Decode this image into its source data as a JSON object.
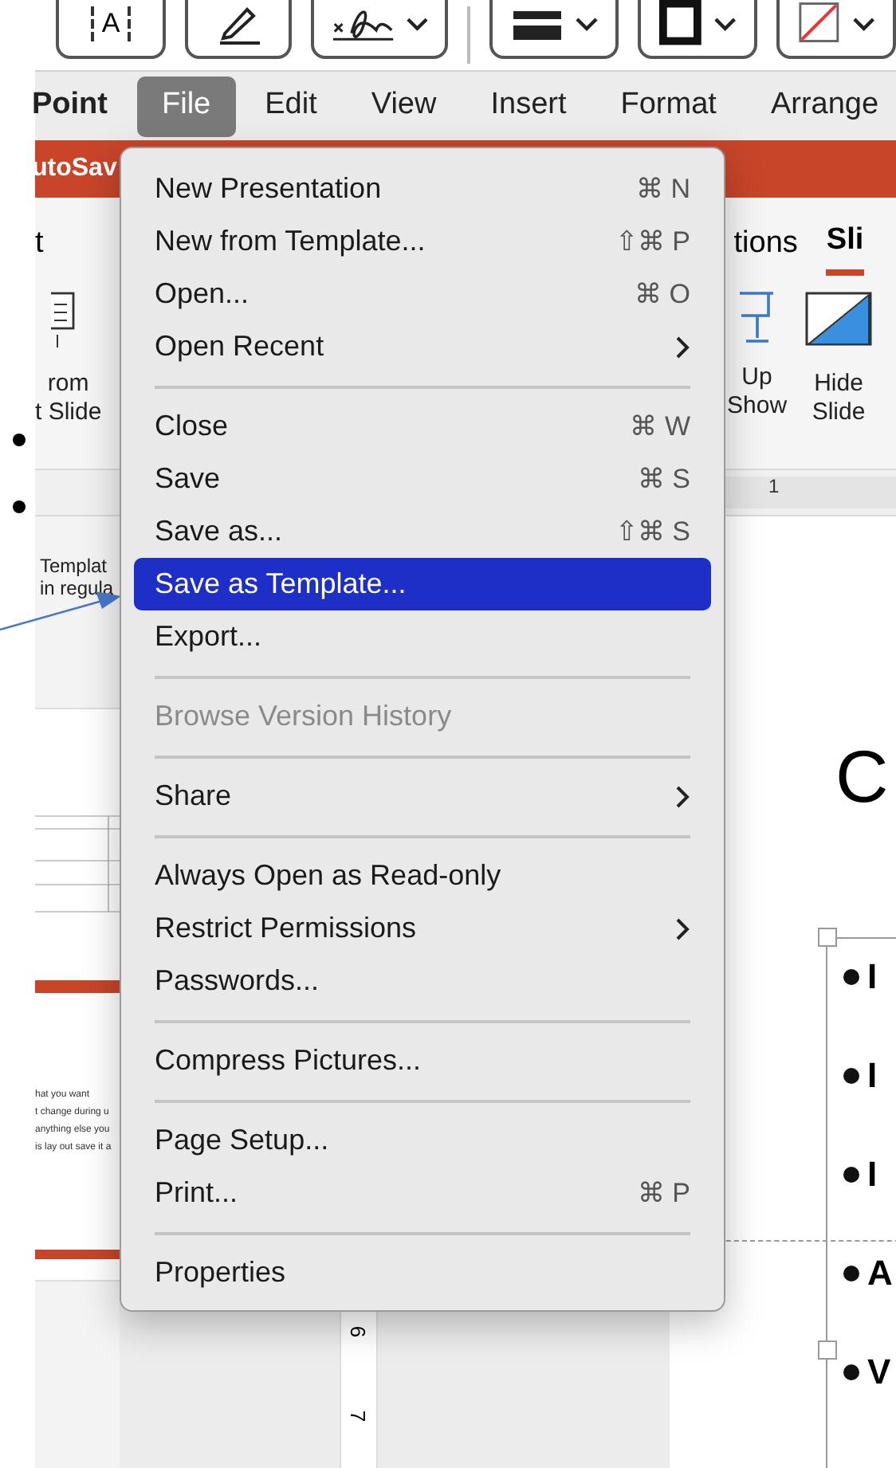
{
  "toolbar": [
    {
      "kind": "textbox",
      "label": "A",
      "dropdown": false
    },
    {
      "kind": "pen",
      "dropdown": false
    },
    {
      "kind": "signature",
      "dropdown": true
    },
    {
      "kind": "divider"
    },
    {
      "kind": "line_weight",
      "dropdown": true
    },
    {
      "kind": "border",
      "dropdown": true
    },
    {
      "kind": "no_color",
      "dropdown": true
    }
  ],
  "menu_bar": [
    {
      "label": "Point",
      "kind": "app"
    },
    {
      "label": "File",
      "kind": "menu",
      "selected": true
    },
    {
      "label": "Edit",
      "kind": "menu",
      "selected": false
    },
    {
      "label": "View",
      "kind": "menu",
      "selected": false
    },
    {
      "label": "Insert",
      "kind": "menu",
      "selected": false
    },
    {
      "label": "Format",
      "kind": "menu",
      "selected": false
    },
    {
      "label": "Arrange",
      "kind": "menu",
      "selected": false
    }
  ],
  "title_bar": {
    "autosave": "utoSav"
  },
  "ribbon": {
    "tabs": [
      {
        "label": "t",
        "selected": false
      },
      {
        "label": "tions",
        "selected": false
      },
      {
        "label": "Sli",
        "selected": true
      }
    ],
    "buttons": [
      {
        "kind": "layout",
        "lines": [
          "rom",
          "t Slide"
        ]
      },
      {
        "kind": "show",
        "lines": [
          "Up",
          "Show"
        ]
      },
      {
        "kind": "hide",
        "lines": [
          "Hide",
          "Slide"
        ]
      }
    ],
    "ruler": "1"
  },
  "annotation": {
    "lines": [
      "Templat",
      "in regula"
    ]
  },
  "thumbnail": {
    "lines": [
      "hat you want",
      "t change during u",
      "anything else you",
      "is lay out save it a"
    ]
  },
  "vertical_ruler": [
    "6",
    "7"
  ],
  "slide": {
    "title": "C",
    "bullets": [
      "I",
      "I",
      "I",
      "A",
      "V"
    ]
  },
  "file_menu": [
    {
      "kind": "item",
      "label": "New Presentation",
      "shortcut": "⌘ N",
      "submenu": false,
      "disabled": false,
      "selected": false
    },
    {
      "kind": "item",
      "label": "New from Template...",
      "shortcut": "⇧⌘ P",
      "submenu": false,
      "disabled": false,
      "selected": false
    },
    {
      "kind": "item",
      "label": "Open...",
      "shortcut": "⌘ O",
      "submenu": false,
      "disabled": false,
      "selected": false
    },
    {
      "kind": "item",
      "label": "Open Recent",
      "submenu": true,
      "disabled": false,
      "selected": false
    },
    {
      "kind": "separator"
    },
    {
      "kind": "item",
      "label": "Close",
      "shortcut": "⌘ W",
      "submenu": false,
      "disabled": false,
      "selected": false
    },
    {
      "kind": "item",
      "label": "Save",
      "shortcut": "⌘ S",
      "submenu": false,
      "disabled": false,
      "selected": false
    },
    {
      "kind": "item",
      "label": "Save as...",
      "shortcut": "⇧⌘ S",
      "submenu": false,
      "disabled": false,
      "selected": false
    },
    {
      "kind": "item",
      "label": "Save as Template...",
      "submenu": false,
      "disabled": false,
      "selected": true
    },
    {
      "kind": "item",
      "label": "Export...",
      "submenu": false,
      "disabled": false,
      "selected": false
    },
    {
      "kind": "separator"
    },
    {
      "kind": "item",
      "label": "Browse Version History",
      "submenu": false,
      "disabled": true,
      "selected": false
    },
    {
      "kind": "separator"
    },
    {
      "kind": "item",
      "label": "Share",
      "submenu": true,
      "disabled": false,
      "selected": false
    },
    {
      "kind": "separator"
    },
    {
      "kind": "item",
      "label": "Always Open as Read-only",
      "submenu": false,
      "disabled": false,
      "selected": false
    },
    {
      "kind": "item",
      "label": "Restrict Permissions",
      "submenu": true,
      "disabled": false,
      "selected": false
    },
    {
      "kind": "item",
      "label": "Passwords...",
      "submenu": false,
      "disabled": false,
      "selected": false
    },
    {
      "kind": "separator"
    },
    {
      "kind": "item",
      "label": "Compress Pictures...",
      "submenu": false,
      "disabled": false,
      "selected": false
    },
    {
      "kind": "separator"
    },
    {
      "kind": "item",
      "label": "Page Setup...",
      "submenu": false,
      "disabled": false,
      "selected": false
    },
    {
      "kind": "item",
      "label": "Print...",
      "shortcut": "⌘ P",
      "submenu": false,
      "disabled": false,
      "selected": false
    },
    {
      "kind": "separator"
    },
    {
      "kind": "item",
      "label": "Properties",
      "submenu": false,
      "disabled": false,
      "selected": false
    }
  ]
}
